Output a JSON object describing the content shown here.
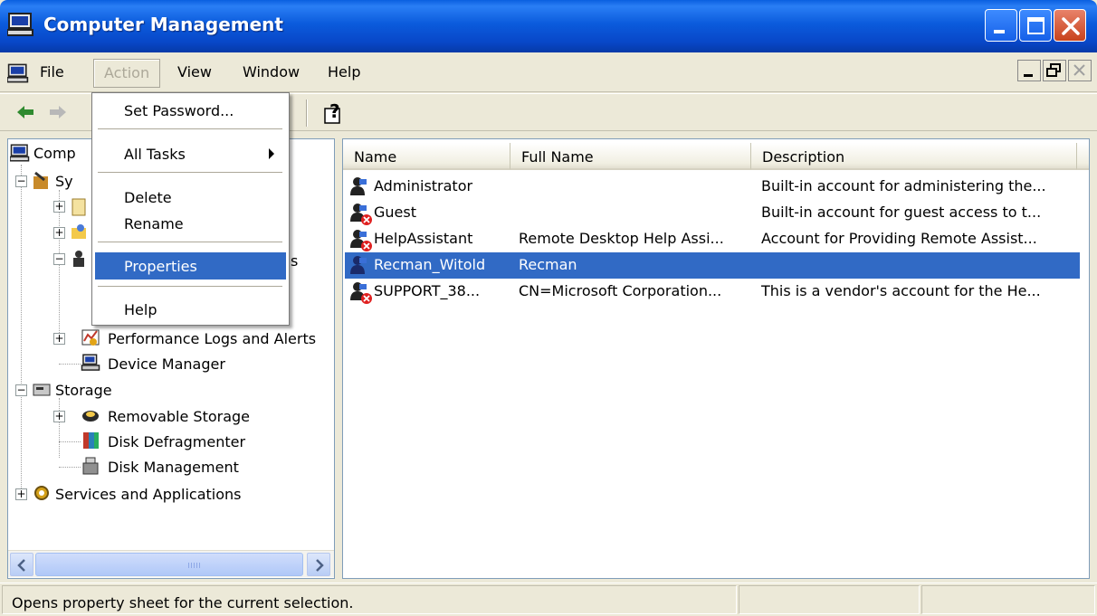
{
  "window": {
    "title": "Computer Management"
  },
  "menubar": {
    "items": [
      "File",
      "Action",
      "View",
      "Window",
      "Help"
    ]
  },
  "dropdown": {
    "items": [
      {
        "label": "Set Password..."
      },
      {
        "label": "All Tasks"
      },
      {
        "label": "Delete"
      },
      {
        "label": "Rename"
      },
      {
        "label": "Properties"
      },
      {
        "label": "Help"
      }
    ]
  },
  "tree": {
    "root": "Comp",
    "sys_partial": "Sy",
    "perf": "Performance Logs and Alerts",
    "device_manager": "Device Manager",
    "storage": "Storage",
    "removable": "Removable Storage",
    "defrag": "Disk Defragmenter",
    "diskmgmt": "Disk Management",
    "services": "Services and Applications",
    "tail_partial": "s"
  },
  "list": {
    "columns": [
      "Name",
      "Full Name",
      "Description"
    ],
    "rows": [
      {
        "name": "Administrator",
        "full_name": "",
        "description": "Built-in account for administering the...",
        "disabled": false,
        "selected": false
      },
      {
        "name": "Guest",
        "full_name": "",
        "description": "Built-in account for guest access to t...",
        "disabled": true,
        "selected": false
      },
      {
        "name": "HelpAssistant",
        "full_name": "Remote Desktop Help Assi...",
        "description": "Account for Providing Remote Assist...",
        "disabled": true,
        "selected": false
      },
      {
        "name": "Recman_Witold",
        "full_name": "Recman",
        "description": "",
        "disabled": false,
        "selected": true
      },
      {
        "name": "SUPPORT_38...",
        "full_name": "CN=Microsoft Corporation...",
        "description": "This is a vendor's account for the He...",
        "disabled": true,
        "selected": false
      }
    ]
  },
  "statusbar": {
    "message": "Opens property sheet for the current selection."
  },
  "colors": {
    "selection": "#316ac5",
    "titlebar": "#0b5bdc",
    "face": "#ece9d8"
  }
}
